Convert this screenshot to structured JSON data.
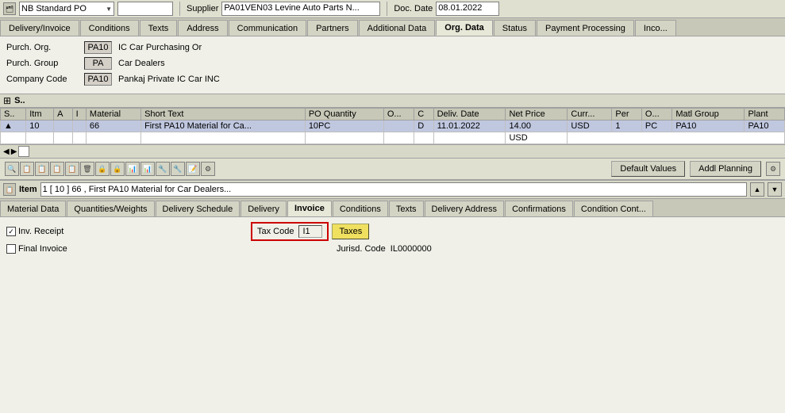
{
  "header": {
    "doc_type_label": "NB Standard PO",
    "supplier_label": "Supplier",
    "supplier_value": "PA01VEN03 Levine Auto Parts N...",
    "doc_date_label": "Doc. Date",
    "doc_date_value": "08.01.2022"
  },
  "top_tabs": [
    {
      "id": "delivery_invoice",
      "label": "Delivery/Invoice",
      "active": false
    },
    {
      "id": "conditions",
      "label": "Conditions",
      "active": false
    },
    {
      "id": "texts",
      "label": "Texts",
      "active": false
    },
    {
      "id": "address",
      "label": "Address",
      "active": false
    },
    {
      "id": "communication",
      "label": "Communication",
      "active": false
    },
    {
      "id": "partners",
      "label": "Partners",
      "active": false
    },
    {
      "id": "additional_data",
      "label": "Additional Data",
      "active": false
    },
    {
      "id": "org_data",
      "label": "Org. Data",
      "active": true
    },
    {
      "id": "status",
      "label": "Status",
      "active": false
    },
    {
      "id": "payment_processing",
      "label": "Payment Processing",
      "active": false
    },
    {
      "id": "inco",
      "label": "Inco...",
      "active": false
    }
  ],
  "org_data": {
    "purch_org_label": "Purch. Org.",
    "purch_org_code": "PA10",
    "purch_org_value": "IC Car Purchasing Or",
    "purch_group_label": "Purch. Group",
    "purch_group_code": "PA",
    "purch_group_value": "Car Dealers",
    "company_code_label": "Company Code",
    "company_code_code": "PA10",
    "company_code_value": "Pankaj Private IC Car INC"
  },
  "grid": {
    "columns": [
      "S..",
      "Itm",
      "A",
      "I",
      "Material",
      "Short Text",
      "PO Quantity",
      "O...",
      "C",
      "Deliv. Date",
      "Net Price",
      "Curr...",
      "Per",
      "O...",
      "Matl Group",
      "Plant"
    ],
    "rows": [
      {
        "status": "▲",
        "itm": "10",
        "a": "",
        "i": "",
        "material": "66",
        "short_text": "First PA10 Material for Ca...",
        "po_quantity": "10PC",
        "o": "",
        "c": "D",
        "deliv_date": "11.01.2022",
        "net_price": "14.00",
        "curr": "USD",
        "per": "1",
        "o2": "",
        "pc": "PC",
        "matl_group": "PA10",
        "plant": "PA10"
      }
    ],
    "currency_row": "USD"
  },
  "action_toolbar": {
    "default_values_btn": "Default Values",
    "addl_planning_btn": "Addl Planning"
  },
  "item_section": {
    "label": "Item",
    "selector_value": "1 [ 10 ] 66 , First PA10 Material for Car Dealers..."
  },
  "bottom_tabs": [
    {
      "id": "material_data",
      "label": "Material Data",
      "active": false
    },
    {
      "id": "quantities_weights",
      "label": "Quantities/Weights",
      "active": false
    },
    {
      "id": "delivery_schedule",
      "label": "Delivery Schedule",
      "active": false
    },
    {
      "id": "delivery",
      "label": "Delivery",
      "active": false
    },
    {
      "id": "invoice",
      "label": "Invoice",
      "active": true
    },
    {
      "id": "conditions",
      "label": "Conditions",
      "active": false
    },
    {
      "id": "texts",
      "label": "Texts",
      "active": false
    },
    {
      "id": "delivery_address",
      "label": "Delivery Address",
      "active": false
    },
    {
      "id": "confirmations",
      "label": "Confirmations",
      "active": false
    },
    {
      "id": "condition_cont",
      "label": "Condition Cont...",
      "active": false
    }
  ],
  "invoice_tab": {
    "inv_receipt_label": "Inv. Receipt",
    "inv_receipt_checked": true,
    "final_invoice_label": "Final Invoice",
    "final_invoice_checked": false,
    "tax_code_label": "Tax Code",
    "tax_code_value": "I1",
    "taxes_btn_label": "Taxes",
    "juris_code_label": "Jurisd. Code",
    "juris_code_value": "IL0000000"
  }
}
